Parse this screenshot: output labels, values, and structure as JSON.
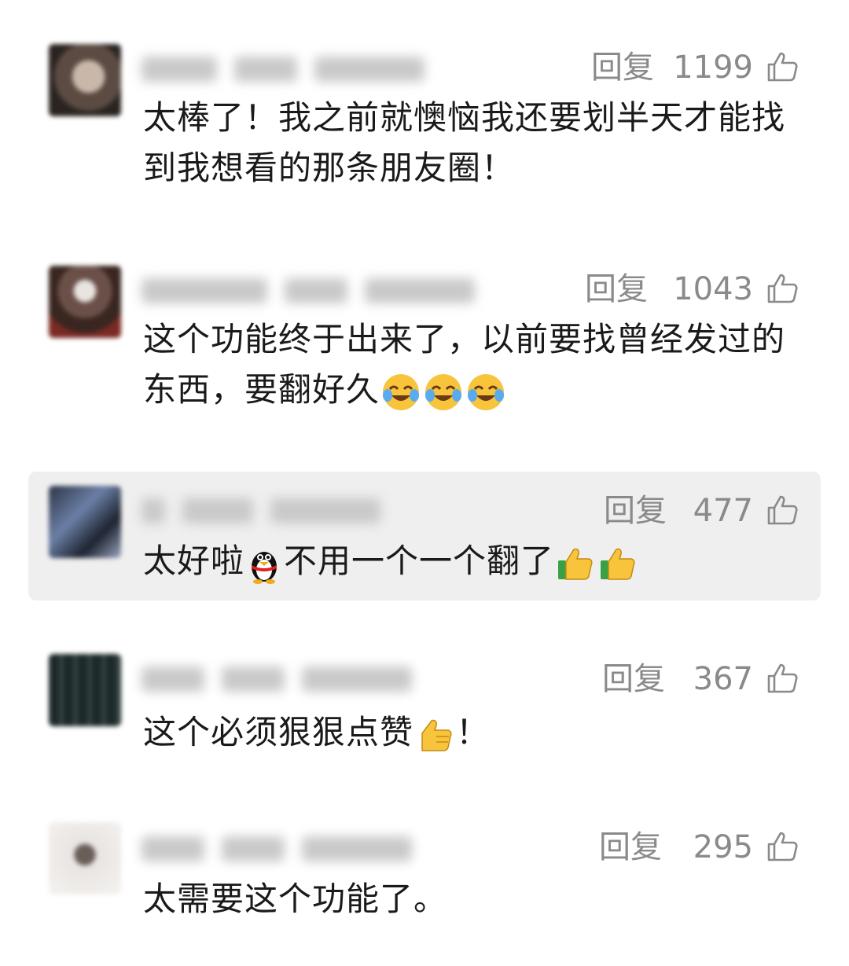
{
  "comments": [
    {
      "reply_label": "回复",
      "likes": "1199",
      "text": "太棒了！我之前就懊恼我还要划半天才能找到我想看的那条朋友圈！"
    },
    {
      "reply_label": "回复",
      "likes": "1043",
      "text_before": "这个功能终于出来了，以前要找曾经发过的东西，要翻好久",
      "emoji": [
        "crying-laughing-emoji",
        "crying-laughing-emoji",
        "crying-laughing-emoji"
      ]
    },
    {
      "reply_label": "回复",
      "likes": "477",
      "text_part1": "太好啦",
      "text_part2": "不用一个一个翻了",
      "emoji_mid": "qq-penguin-emoji",
      "emoji_end": [
        "thumbs-up-emoji",
        "thumbs-up-emoji"
      ]
    },
    {
      "reply_label": "回复",
      "likes": "367",
      "text_before": "这个必须狠狠点赞",
      "text_after": "！",
      "emoji": "thumbs-up-emoji"
    },
    {
      "reply_label": "回复",
      "likes": "295",
      "text": "太需要这个功能了。"
    }
  ],
  "colors": {
    "meta_gray": "#8a8a8a",
    "text": "#1a1a1a",
    "highlight_bg": "#efefef"
  }
}
